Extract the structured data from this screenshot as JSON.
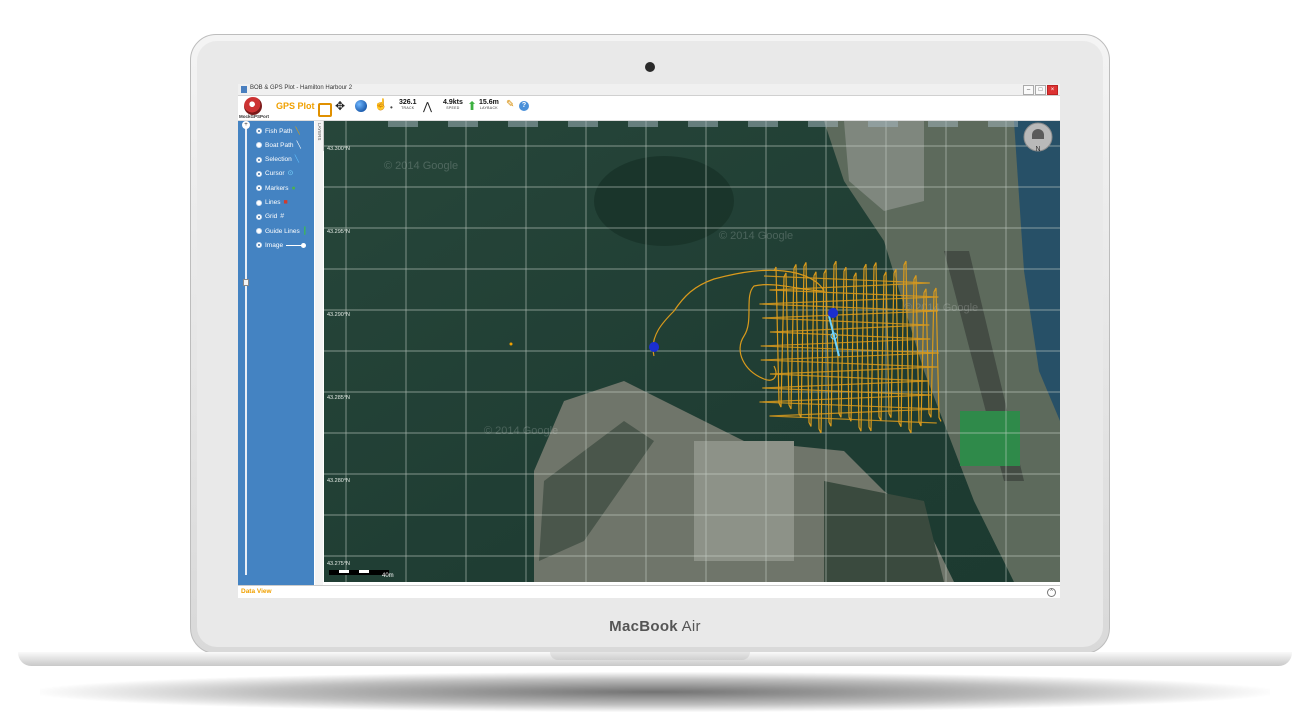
{
  "device": {
    "brand_main": "MacBook",
    "brand_sub": "Air"
  },
  "window": {
    "title": "BOB & GPS Plot - Hamilton Harbour 2",
    "buttons": [
      "–",
      "□",
      "×"
    ]
  },
  "toolbar": {
    "logo_text": "MockGPSPort",
    "app_title": "GPS Plot",
    "track": {
      "value": "326.1",
      "label": "TRACK"
    },
    "speed": {
      "value": "4.9kts",
      "label": "SPEED"
    },
    "depth": {
      "value": "15.6m",
      "label": "LAYBACK"
    },
    "help": "?"
  },
  "sidebar": {
    "layers": [
      {
        "label": "Fish Path",
        "on": true,
        "swatch": "╲",
        "swatch_color": "#e0a000"
      },
      {
        "label": "Boat Path",
        "on": false,
        "swatch": "╲",
        "swatch_color": "#ffffff"
      },
      {
        "label": "Selection",
        "on": true,
        "swatch": "╲",
        "swatch_color": "#60c0ff"
      },
      {
        "label": "Cursor",
        "on": true,
        "swatch": "⊙",
        "swatch_color": "#7ad7ff"
      },
      {
        "label": "Markers",
        "on": true,
        "swatch": "●",
        "swatch_color": "#4caf50"
      },
      {
        "label": "Lines",
        "on": false,
        "swatch": "■",
        "swatch_color": "#d23b2b"
      },
      {
        "label": "Grid",
        "on": true,
        "swatch": "#",
        "swatch_color": "#dfe8f2"
      },
      {
        "label": "Guide Lines",
        "on": false,
        "swatch": "┃",
        "swatch_color": "#3cc040"
      },
      {
        "label": "Image",
        "on": true,
        "swatch": "",
        "swatch_color": "#ffffff"
      }
    ]
  },
  "layers_tab": "LAYERS",
  "map": {
    "lat_labels": [
      "43.300°N",
      "43.295°N",
      "43.290°N",
      "43.285°N",
      "43.280°N",
      "43.275°N"
    ],
    "watermarks": [
      "© 2014 Google",
      "© 2014 Google",
      "© 2014 Google",
      "© 2014 Google"
    ],
    "scale_label": "40m",
    "compass_label": "N",
    "colors": {
      "water": "#1f3b31",
      "track": "#d99a1c",
      "marker": "#1b2fd0",
      "grid": "#cfd8d0"
    }
  },
  "data_view": {
    "title": "Data View"
  }
}
